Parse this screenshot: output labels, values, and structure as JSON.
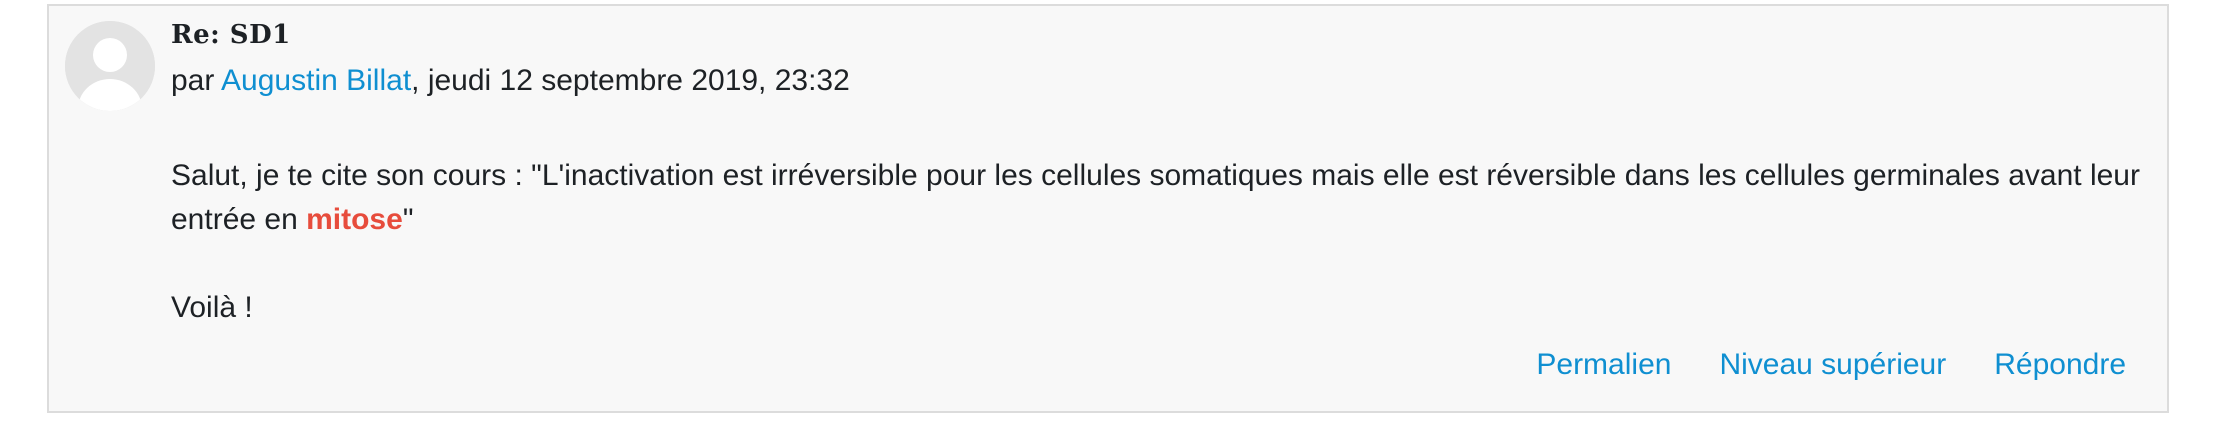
{
  "post": {
    "subject": "Re: SD1",
    "byline_prefix": "par ",
    "author": "Augustin Billat",
    "byline_suffix": ", jeudi 12 septembre 2019, 23:32",
    "body": {
      "para1_before": "Salut, je te cite son cours : \"L'inactivation est irréversible pour les cellules somatiques mais elle est réversible dans les cellules germinales avant leur entrée en ",
      "para1_highlight": "mitose",
      "para1_after": "\"",
      "para2": "Voilà !"
    },
    "commands": {
      "permalink": "Permalien",
      "parent": "Niveau supérieur",
      "reply": "Répondre"
    }
  },
  "colors": {
    "link": "#0f8fd1",
    "highlight": "#e74c3c",
    "background": "#f8f8f8",
    "border": "#dcdcdc",
    "avatar": "#e3e3e3"
  },
  "icons": {
    "avatar": "default-user-icon"
  }
}
